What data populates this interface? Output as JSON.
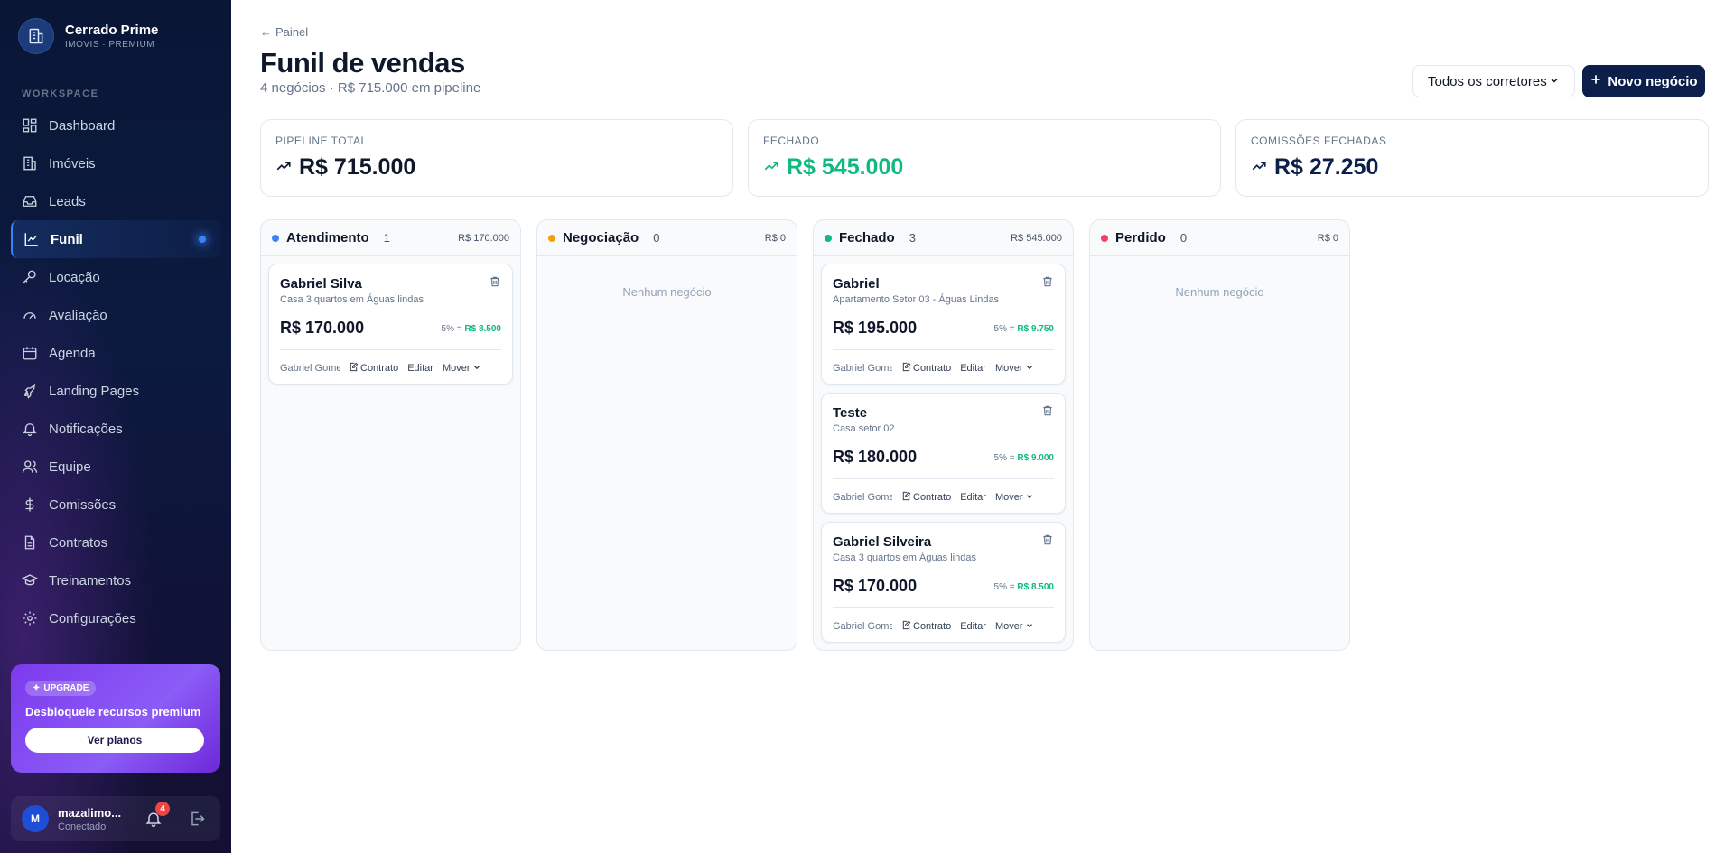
{
  "brand": {
    "name": "Cerrado Prime",
    "subtitle": "IMOVIS · PREMIUM"
  },
  "sidebar": {
    "section": "WORKSPACE",
    "items": [
      {
        "label": "Dashboard",
        "icon": "grid-icon"
      },
      {
        "label": "Imóveis",
        "icon": "building-icon"
      },
      {
        "label": "Leads",
        "icon": "inbox-icon"
      },
      {
        "label": "Funil",
        "icon": "chart-line-icon",
        "active": true
      },
      {
        "label": "Locação",
        "icon": "key-icon"
      },
      {
        "label": "Avaliação",
        "icon": "gauge-icon"
      },
      {
        "label": "Agenda",
        "icon": "calendar-icon"
      },
      {
        "label": "Landing Pages",
        "icon": "rocket-icon"
      },
      {
        "label": "Notificações",
        "icon": "bell-icon"
      },
      {
        "label": "Equipe",
        "icon": "users-icon"
      },
      {
        "label": "Comissões",
        "icon": "dollar-icon"
      },
      {
        "label": "Contratos",
        "icon": "file-icon"
      },
      {
        "label": "Treinamentos",
        "icon": "graduation-cap-icon"
      },
      {
        "label": "Configurações",
        "icon": "gear-icon"
      }
    ],
    "upgrade": {
      "badge": "UPGRADE",
      "title": "Desbloqueie recursos premium",
      "button": "Ver planos"
    },
    "user": {
      "initial": "M",
      "name": "mazalimo...",
      "status": "Conectado",
      "notifications": "4"
    }
  },
  "header": {
    "breadcrumb": "Painel",
    "title": "Funil de vendas",
    "subtitle": "4 negócios · R$ 715.000 em pipeline",
    "broker_filter": "Todos os corretores",
    "new_button": "Novo negócio"
  },
  "stats": [
    {
      "label": "PIPELINE TOTAL",
      "value": "R$ 715.000",
      "color": "#0f172a"
    },
    {
      "label": "FECHADO",
      "value": "R$ 545.000",
      "color": "#10b981"
    },
    {
      "label": "COMISSÕES FECHADAS",
      "value": "R$ 27.250",
      "color": "#0b1f4a"
    }
  ],
  "columns": [
    {
      "title": "Atendimento",
      "count": "1",
      "total": "R$ 170.000",
      "color": "#3b82f6",
      "cards": [
        {
          "name": "Gabriel Silva",
          "desc": "Casa 3 quartos em Águas lindas",
          "value": "R$ 170.000",
          "rate": "5% = ",
          "commission": "R$ 8.500",
          "broker": "Gabriel Gomes",
          "contract": "Contrato",
          "edit": "Editar",
          "move": "Mover"
        }
      ]
    },
    {
      "title": "Negociação",
      "count": "0",
      "total": "R$ 0",
      "color": "#f59e0b",
      "empty": "Nenhum negócio",
      "cards": []
    },
    {
      "title": "Fechado",
      "count": "3",
      "total": "R$ 545.000",
      "color": "#10b981",
      "cards": [
        {
          "name": "Gabriel",
          "desc": "Apartamento Setor 03 - Águas Lindas",
          "value": "R$ 195.000",
          "rate": "5% = ",
          "commission": "R$ 9.750",
          "broker": "Gabriel Gomes",
          "contract": "Contrato",
          "edit": "Editar",
          "move": "Mover"
        },
        {
          "name": "Teste",
          "desc": "Casa setor 02",
          "value": "R$ 180.000",
          "rate": "5% = ",
          "commission": "R$ 9.000",
          "broker": "Gabriel Gomes",
          "contract": "Contrato",
          "edit": "Editar",
          "move": "Mover"
        },
        {
          "name": "Gabriel Silveira",
          "desc": "Casa 3 quartos em Águas lindas",
          "value": "R$ 170.000",
          "rate": "5% = ",
          "commission": "R$ 8.500",
          "broker": "Gabriel Gomes",
          "contract": "Contrato",
          "edit": "Editar",
          "move": "Mover"
        }
      ]
    },
    {
      "title": "Perdido",
      "count": "0",
      "total": "R$ 0",
      "color": "#f43f5e",
      "empty": "Nenhum negócio",
      "cards": []
    }
  ]
}
